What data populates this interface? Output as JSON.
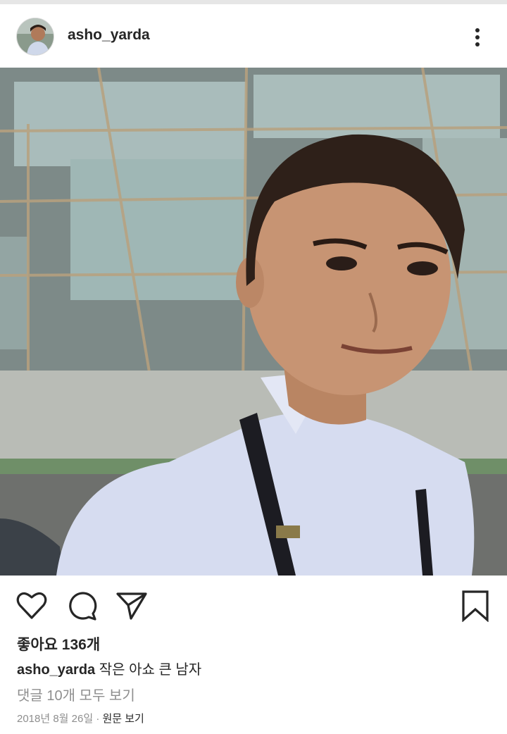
{
  "header": {
    "username": "asho_yarda",
    "avatar_icon": "profile-avatar",
    "more_icon": "more-vertical-icon"
  },
  "photo": {
    "icon": "post-photo-boy-in-blue-shirt"
  },
  "actions": {
    "like_icon": "heart-icon",
    "comment_icon": "comment-icon",
    "share_icon": "send-icon",
    "save_icon": "bookmark-icon"
  },
  "likes": {
    "text": "좋아요 136개"
  },
  "caption": {
    "username": "asho_yarda",
    "text": "작은 아쇼 큰 남자"
  },
  "comments": {
    "view_all": "댓글 10개 모두 보기"
  },
  "meta": {
    "date": "2018년 8월 26일",
    "separator": "·",
    "view_original": "원문 보기"
  },
  "colors": {
    "text": "#262626",
    "secondary": "#8e8e8e",
    "border": "#dbdbdb"
  }
}
